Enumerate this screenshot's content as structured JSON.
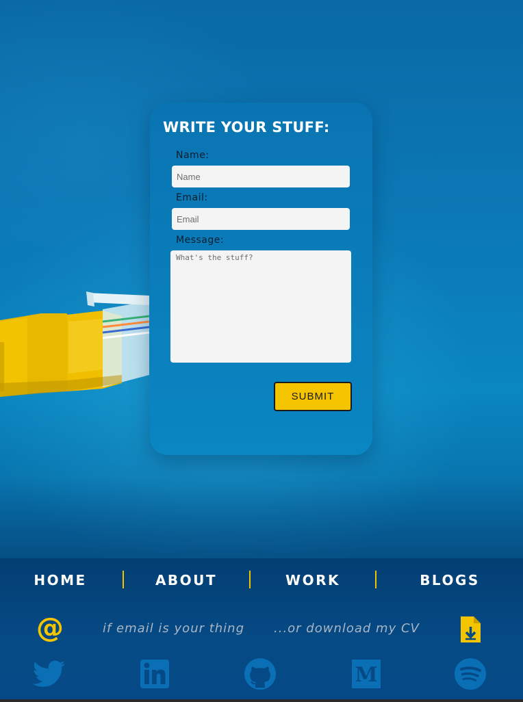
{
  "form": {
    "title": "WRITE YOUR STUFF:",
    "name_label": "Name:",
    "name_placeholder": "Name",
    "email_label": "Email:",
    "email_placeholder": "Email",
    "message_label": "Message:",
    "message_placeholder": "What's the stuff?",
    "submit_label": "SUBMIT"
  },
  "nav": {
    "items": [
      {
        "label": "HOME"
      },
      {
        "label": "ABOUT"
      },
      {
        "label": "WORK"
      },
      {
        "label": "BLOGS"
      }
    ]
  },
  "contact": {
    "email_text": "if email is your thing",
    "cv_text": "...or download my CV",
    "email_icon": "at-sign-icon",
    "cv_icon": "file-download-icon"
  },
  "social": {
    "icons": [
      "twitter-icon",
      "linkedin-icon",
      "github-icon",
      "medium-icon",
      "spotify-icon"
    ]
  },
  "colors": {
    "accent": "#f5c400",
    "card": "#0a7fbd",
    "footer": "#054a86",
    "social_icon": "#0a6fb5"
  }
}
